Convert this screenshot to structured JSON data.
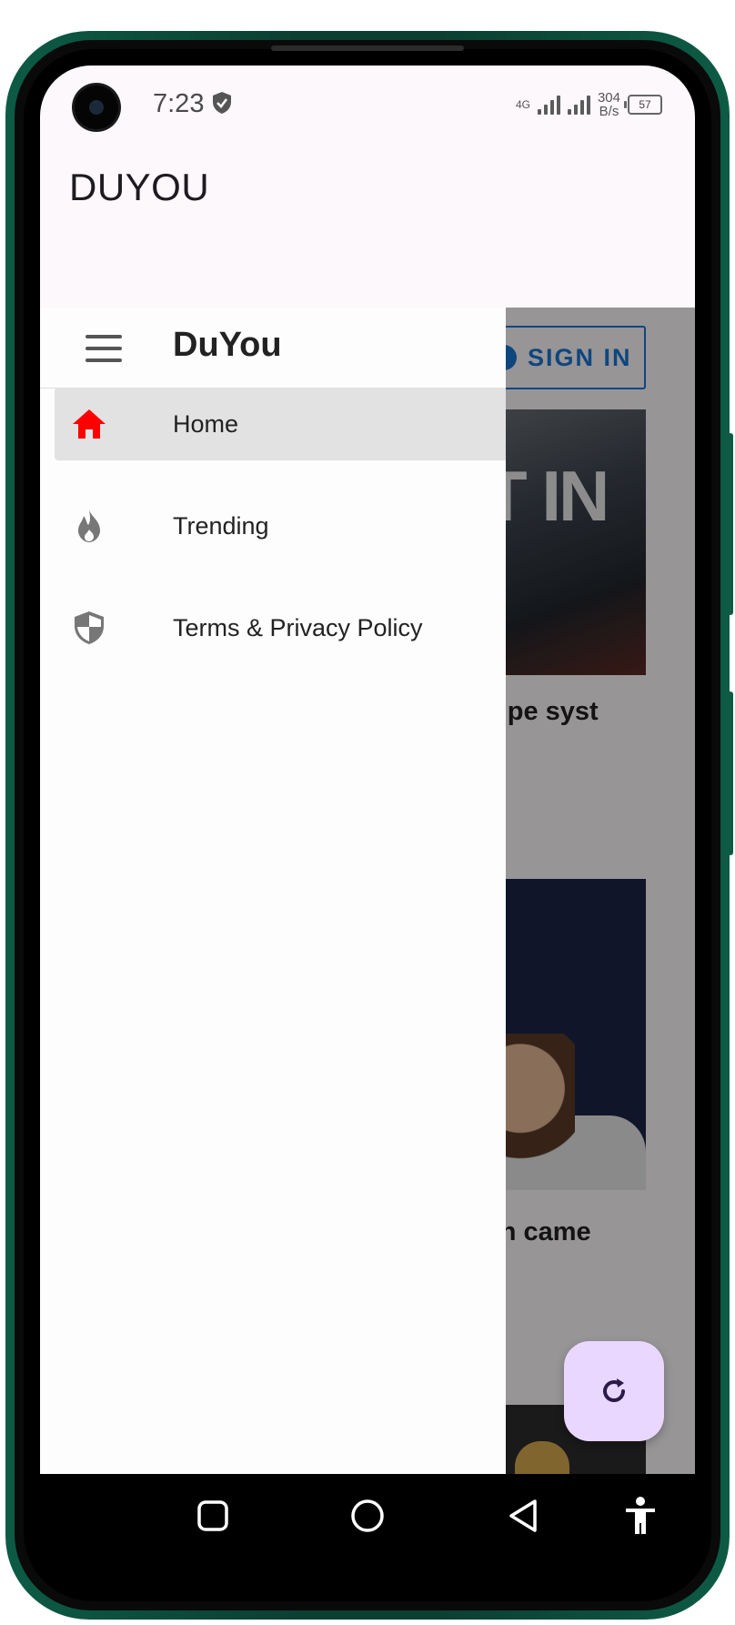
{
  "status_bar": {
    "time": "7:23",
    "network_type": "4G",
    "net_speed_value": "304",
    "net_speed_unit": "B/s",
    "battery": "57"
  },
  "app_bar": {
    "title": "DUYOU"
  },
  "drawer": {
    "title": "DuYou",
    "items": [
      {
        "label": "Home",
        "icon": "home-icon",
        "active": true
      },
      {
        "label": "Trending",
        "icon": "flame-icon",
        "active": false
      },
      {
        "label": "Terms & Privacy Policy",
        "icon": "shield-icon",
        "active": false
      }
    ]
  },
  "content": {
    "sign_in_label": "SIGN IN",
    "image1_text": "T IN",
    "card1_title_fragment": "pipe syst",
    "card2_title_fragment": "on came"
  },
  "colors": {
    "accent_blue": "#1976d2",
    "home_icon_red": "#ff0000",
    "fab_bg": "#ead7ff",
    "frame_green": "#0d5b45"
  },
  "fab": {
    "icon": "refresh-icon"
  },
  "nav_bar": {
    "icons": [
      "recents-square-icon",
      "home-circle-icon",
      "back-triangle-icon",
      "accessibility-icon"
    ]
  }
}
